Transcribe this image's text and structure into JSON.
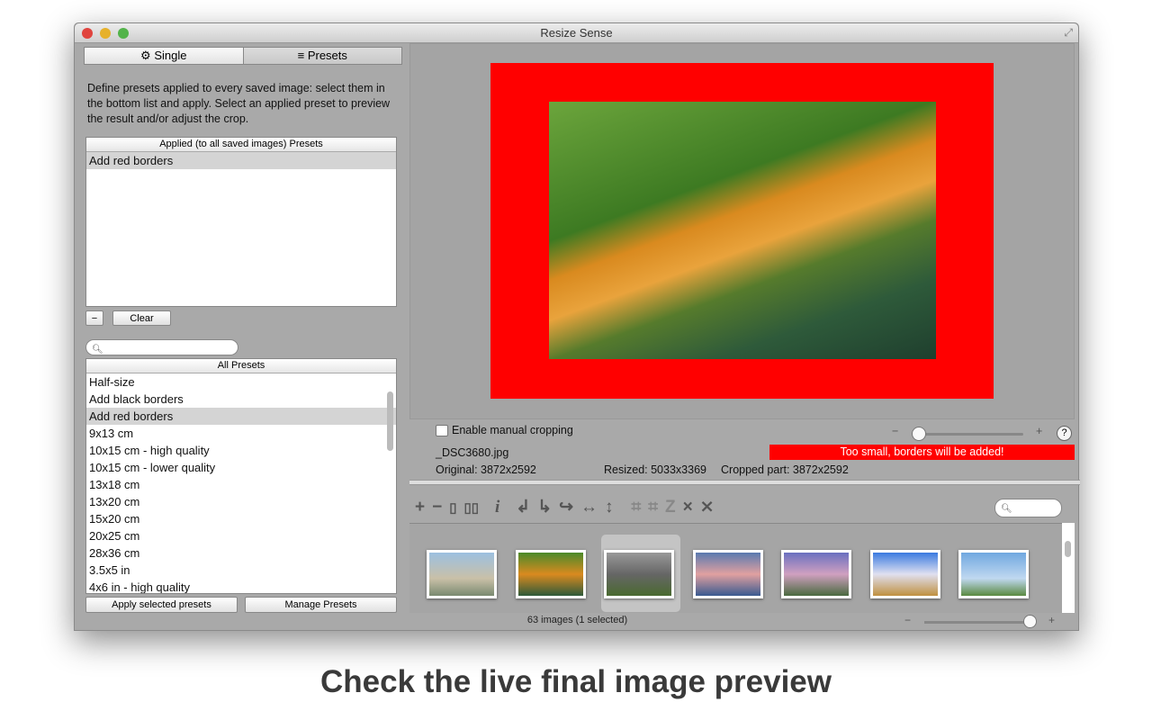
{
  "window": {
    "title": "Resize Sense"
  },
  "tabs": [
    {
      "label": "Single",
      "icon": "gear-icon"
    },
    {
      "label": "Presets",
      "icon": "list-icon"
    }
  ],
  "description": "Define presets applied to every saved image: select them in the bottom list and apply.  Select an applied preset to preview the result and/or adjust the crop.",
  "applied": {
    "header": "Applied (to all saved images) Presets",
    "items": [
      "Add red borders"
    ],
    "remove_label": "−",
    "clear_label": "Clear"
  },
  "all_presets": {
    "header": "All Presets",
    "items": [
      "Half-size",
      "Add black borders",
      "Add red borders",
      "9x13 cm",
      "10x15 cm - high quality",
      "10x15 cm - lower quality",
      "13x18 cm",
      "13x20 cm",
      "15x20 cm",
      "20x25 cm",
      "28x36 cm",
      "3.5x5 in",
      "4x6 in - high quality"
    ],
    "selected_index": 2
  },
  "buttons": {
    "apply": "Apply selected presets",
    "manage": "Manage Presets"
  },
  "preview": {
    "border_color": "#ff0000",
    "manual_crop_label": "Enable manual cropping",
    "filename": "_DSC3680.jpg",
    "warning": "Too small, borders will be added!",
    "original": "Original: 3872x2592",
    "resized": "Resized: 5033x3369",
    "cropped": "Cropped part: 3872x2592",
    "zoom_minus": "−",
    "zoom_plus": "+",
    "help": "?"
  },
  "browser": {
    "status": "63 images (1 selected)",
    "selected_index": 1,
    "zoom_fraction": 0.95,
    "zoom_minus": "−",
    "zoom_plus": "+"
  },
  "caption": "Check the live final image preview"
}
